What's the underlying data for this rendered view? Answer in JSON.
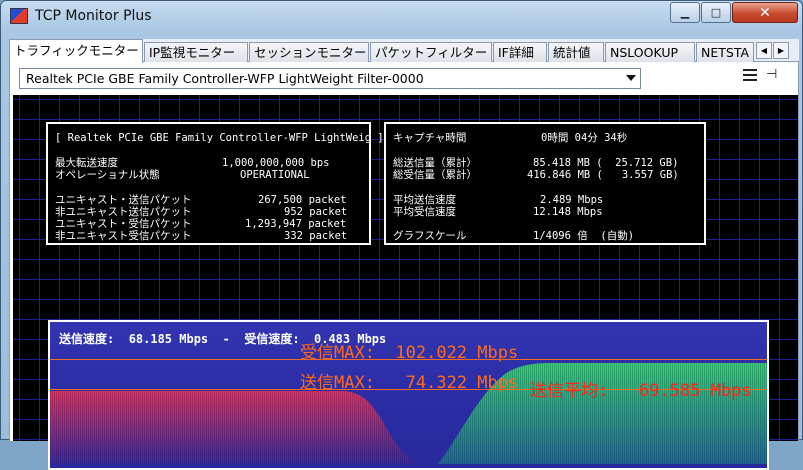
{
  "window": {
    "title": "TCP Monitor Plus",
    "minimize_glyph": "▁",
    "maximize_glyph": "□",
    "close_glyph": "✕"
  },
  "tabs": [
    {
      "label": "トラフィックモニター",
      "active": true
    },
    {
      "label": "IP監視モニター"
    },
    {
      "label": "セッションモニター"
    },
    {
      "label": "パケットフィルター"
    },
    {
      "label": "IF詳細"
    },
    {
      "label": "統計値"
    },
    {
      "label": "NSLOOKUP"
    },
    {
      "label": "NETSTA"
    }
  ],
  "tab_scroll": {
    "left": "◀",
    "right": "▶"
  },
  "adapter": {
    "selected": "Realtek PCIe GBE Family Controller-WFP LightWeight Filter-0000"
  },
  "toolbar": {
    "pin_glyph": "⊣"
  },
  "left_info": {
    "header": "[ Realtek PCIe GBE Family Controller-WFP LightWeig ]",
    "max_speed_label": "最大転送速度",
    "max_speed_value": "1,000,000,000 bps",
    "op_status_label": "オペレーショナル状態",
    "op_status_value": "OPERATIONAL",
    "unicast_sent_label": "ユニキャスト・送信パケット",
    "unicast_sent_value": "267,500 packet",
    "nonunicast_sent_label": "非ユニキャスト送信パケット",
    "nonunicast_sent_value": "952 packet",
    "unicast_recv_label": "ユニキャスト・受信パケット",
    "unicast_recv_value": "1,293,947 packet",
    "nonunicast_recv_label": "非ユニキャスト受信パケット",
    "nonunicast_recv_value": "332 packet"
  },
  "right_info": {
    "capture_time_label": "キャプチャ時間",
    "capture_time_value": "0時間 04分 34秒",
    "total_sent_label": "総送信量（累計）",
    "total_sent_value": "85.418 MB (  25.712 GB)",
    "total_recv_label": "総受信量（累計）",
    "total_recv_value": "416.846 MB (   3.557 GB)",
    "avg_send_label": "平均送信速度",
    "avg_send_value": "2.489 Mbps",
    "avg_recv_label": "平均受信速度",
    "avg_recv_value": "12.148 Mbps",
    "graph_scale_label": "グラフスケール",
    "graph_scale_value": "1/4096 倍  (自動)"
  },
  "graph": {
    "send_speed_label": "送信速度:",
    "send_speed_value": "68.185 Mbps",
    "separator": "-",
    "recv_speed_label": "受信速度:",
    "recv_speed_value": "0.483 Mbps",
    "recv_max_text": "受信MAX:  102.022 Mbps",
    "send_max_text": "送信MAX:   74.322 Mbps",
    "send_avg_text": "送信平均:   69.585 Mbps"
  },
  "colors": {
    "grid": "#2828be",
    "send_fill": "#e0306a",
    "recv_fill": "#29c07a",
    "max_line": "#f06a22",
    "avg_label": "#ff2418"
  }
}
